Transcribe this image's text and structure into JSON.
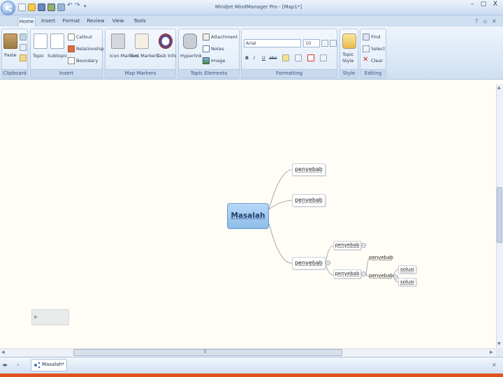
{
  "window": {
    "title": "Mindjet MindManager Pro - [Map1*]",
    "minimize": "–",
    "restore": "▢",
    "close": "X"
  },
  "tabs": [
    "Home",
    "Insert",
    "Format",
    "Review",
    "View",
    "Tools"
  ],
  "ribbon": {
    "clipboard": {
      "group": "Clipboard",
      "paste": "Paste"
    },
    "insert": {
      "group": "Insert",
      "topic": "Topic",
      "subtopic": "Subtopic",
      "callout": "Callout",
      "relationship": "Relationship",
      "boundary": "Boundary"
    },
    "map_markers": {
      "group": "Map Markers",
      "icon_markers": "Icon Markers",
      "text_markers": "Text Markers",
      "task_info": "Task Info"
    },
    "topic_elements": {
      "group": "Topic Elements",
      "hyperlink": "Hyperlink",
      "attachment": "Attachment",
      "notes": "Notes",
      "image": "Image"
    },
    "formatting": {
      "group": "Formatting",
      "font": "Arial",
      "size": "10",
      "bold": "B",
      "italic": "I",
      "underline": "U",
      "strike": "abc"
    },
    "style": {
      "group": "Style",
      "topic_style": "Topic Style"
    },
    "editing": {
      "group": "Editing",
      "find": "Find",
      "select": "Select",
      "clear": "Clear"
    }
  },
  "map": {
    "central": "Masalah",
    "branch1": "penyebab",
    "branch2": "penyebab",
    "branch3": "penyebab",
    "sub1": "penyebab",
    "sub2": "penyebab",
    "sub2a": "penyebab",
    "sub2b": "penyebab",
    "sol1": "solusi",
    "sol2": "solusi"
  },
  "status": {
    "doc_tab": "Masalah*"
  },
  "colors": {
    "accent": "#e0521d",
    "central_fill": "#a8cdf2",
    "ribbon": "#d8e6f6"
  }
}
